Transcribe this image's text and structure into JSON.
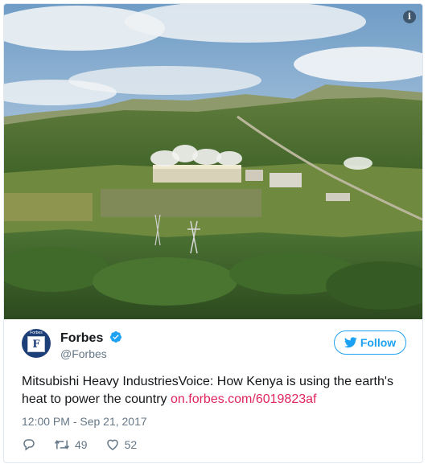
{
  "tweet": {
    "author_name": "Forbes",
    "author_handle": "@Forbes",
    "avatar_text": "Forbes",
    "avatar_letter": "F",
    "follow_label": "Follow",
    "text": "Mitsubishi Heavy IndustriesVoice: How Kenya is using the earth's heat to power the country ",
    "link": "on.forbes.com/6019823af",
    "timestamp": "12:00 PM - Sep 21, 2017",
    "retweets": "49",
    "likes": "52"
  },
  "media": {
    "alt": "Geothermal power plant in green hills with steam plumes",
    "info_label": "i"
  },
  "colors": {
    "accent": "#1da1f2",
    "link": "#e0245e",
    "muted": "#657786",
    "text": "#14171a"
  },
  "icons": [
    "info-icon",
    "verified-badge-icon",
    "twitter-bird-icon",
    "reply-icon",
    "retweet-icon",
    "like-heart-icon"
  ]
}
